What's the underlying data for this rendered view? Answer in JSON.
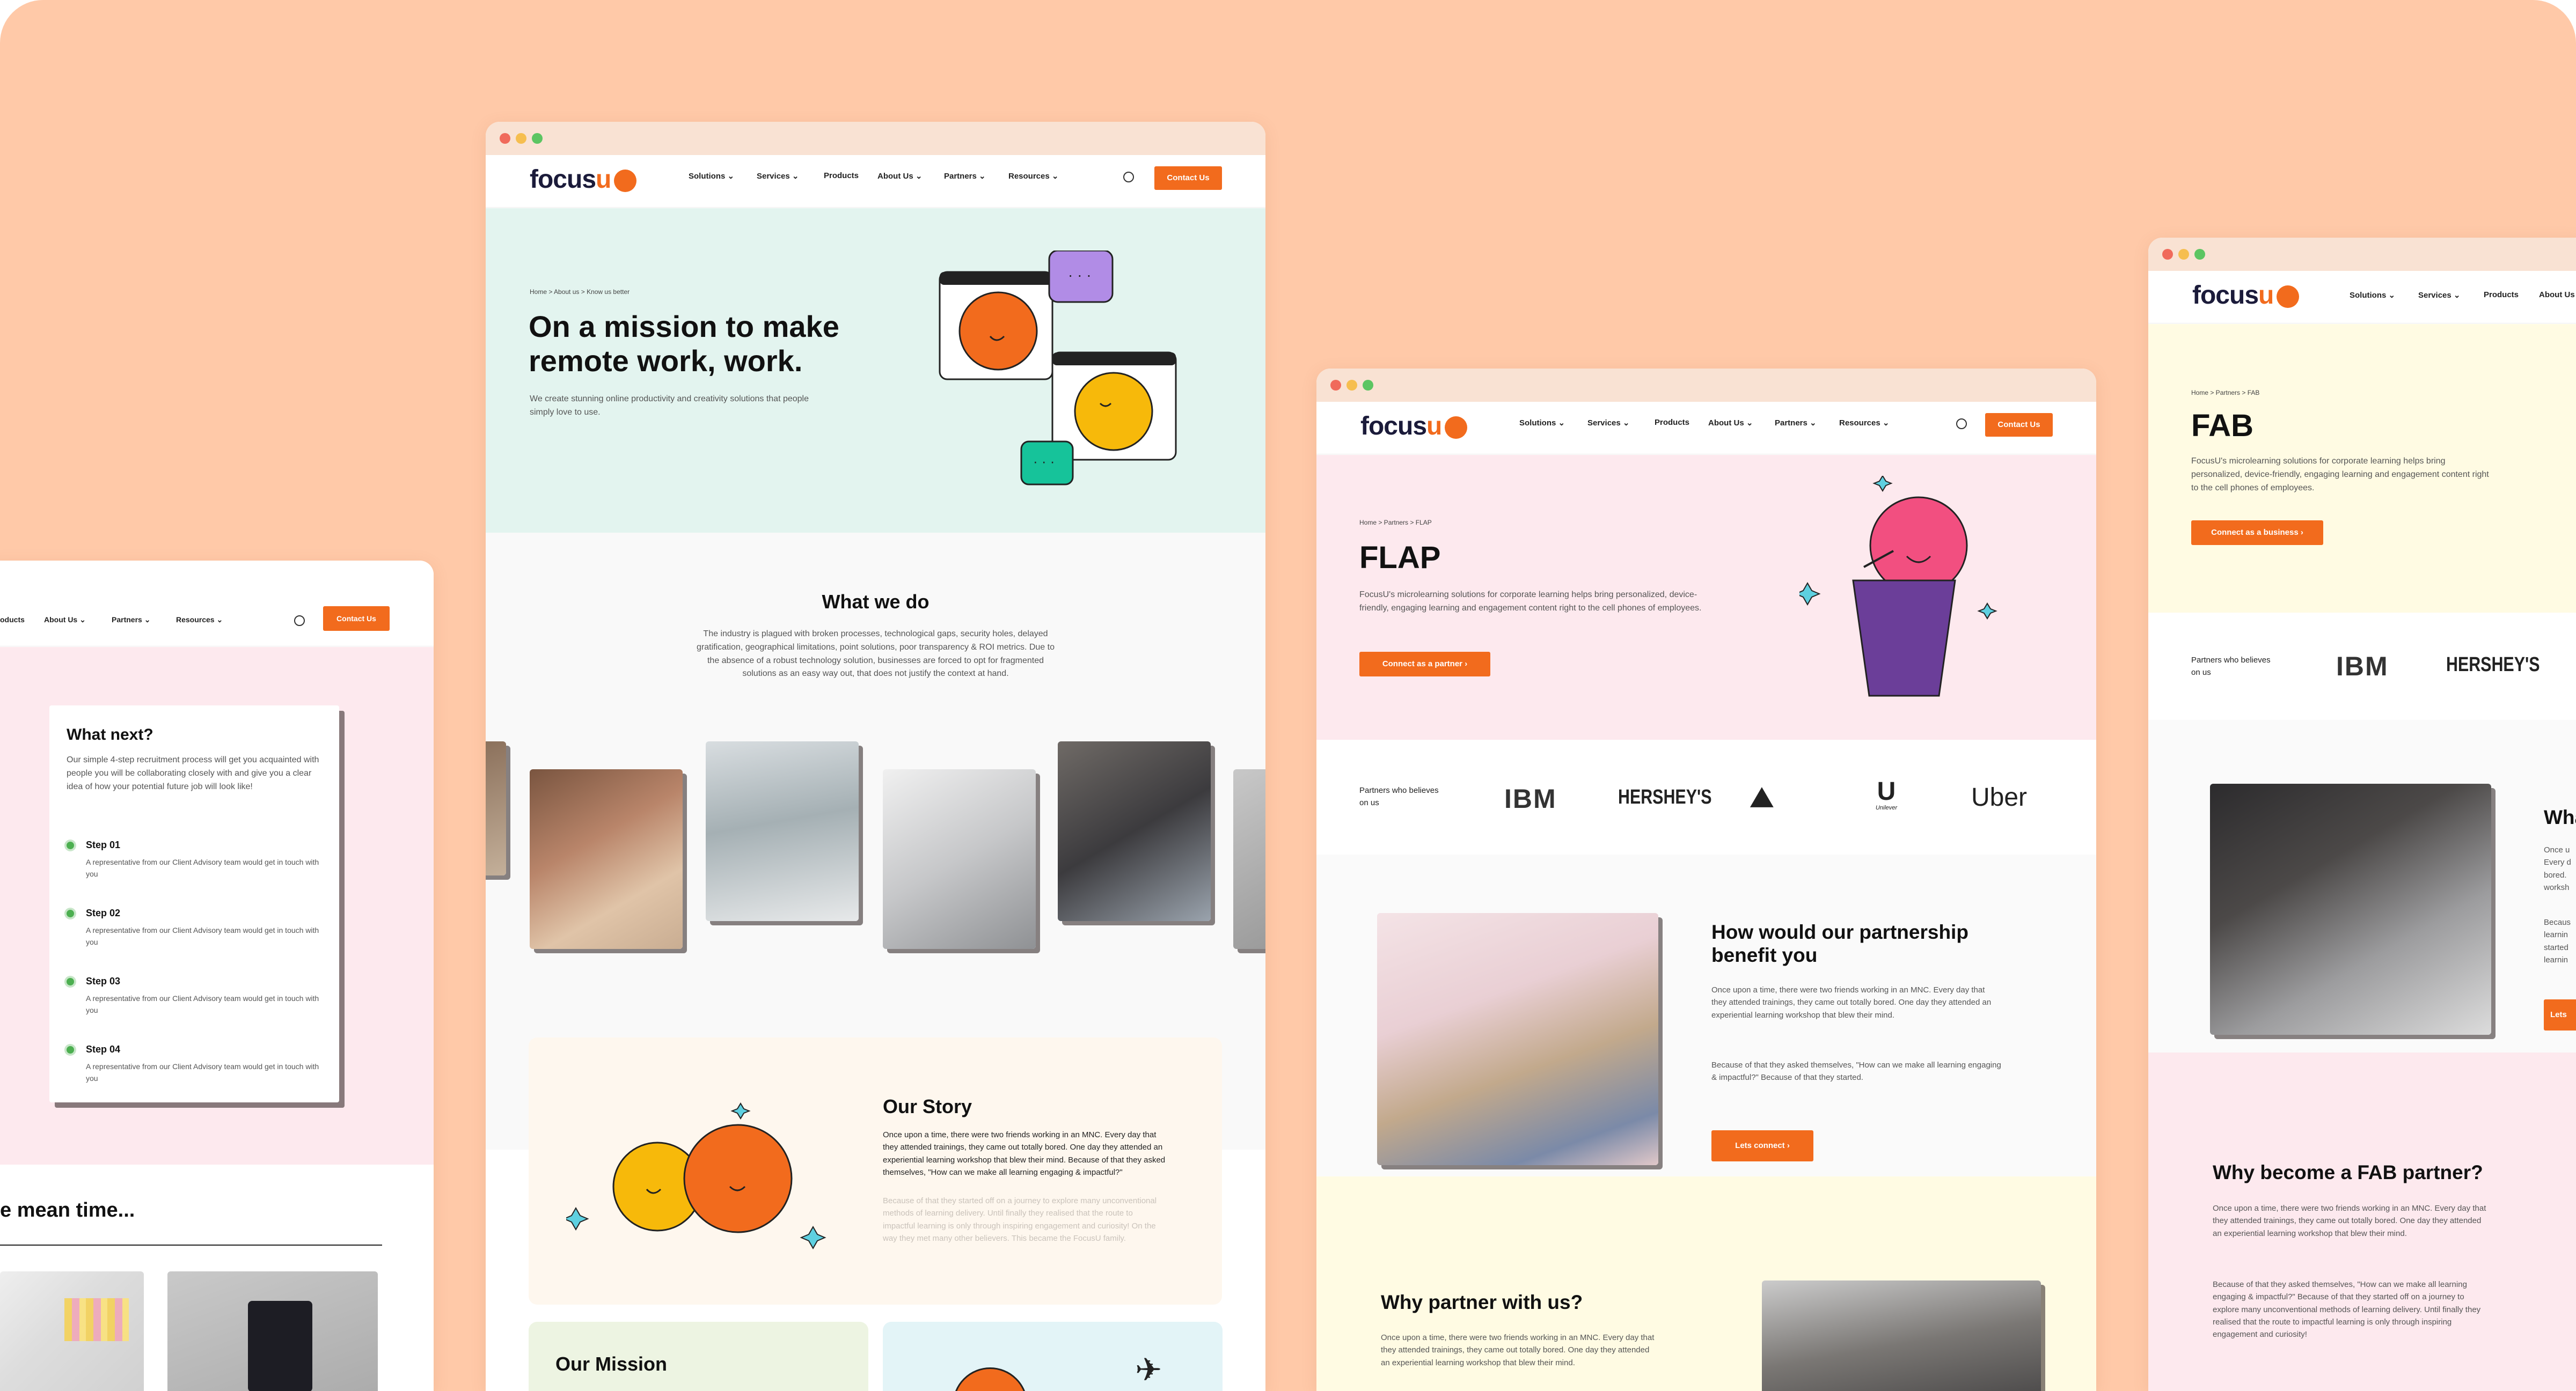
{
  "colors": {
    "canvas": "#ffc9a8",
    "accent": "#f26b1d",
    "mint": "#e3f4ef",
    "pink": "#fde9ee",
    "cream": "#fffbe3",
    "peach": "#fef7ee"
  },
  "logo": {
    "text": "focus",
    "u": "u"
  },
  "nav": {
    "items": [
      "Solutions",
      "Services",
      "Products",
      "About Us",
      "Partners",
      "Resources"
    ],
    "contact": "Contact Us"
  },
  "left_window": {
    "nav": [
      "oducts",
      "About Us",
      "Partners",
      "Resources"
    ],
    "contact": "Contact Us",
    "card_title": "What next?",
    "card_text": "Our simple 4-step recruitment process will get you acquainted with people you will be collaborating closely with and give you a clear idea of how your potential future job will look like!",
    "steps": [
      {
        "title": "Step 01",
        "text": "A representative from our Client Advisory team would get in touch with you"
      },
      {
        "title": "Step 02",
        "text": "A representative from our Client Advisory team would get in touch with you"
      },
      {
        "title": "Step 03",
        "text": "A representative from our Client Advisory team would get in touch with you"
      },
      {
        "title": "Step 04",
        "text": "A representative from our Client Advisory team would get in touch with you"
      }
    ],
    "mean_time": "e mean time..."
  },
  "about_window": {
    "breadcrumb": "Home > About us > Know us better",
    "title_line1": "On a mission to make",
    "title_line2": "remote work, work.",
    "subtitle": "We create stunning online productivity and creativity solutions that people simply love to use.",
    "what_title": "What we do",
    "what_text": "The industry is plagued with broken processes, technological gaps, security holes, delayed gratification, geographical limitations, point solutions, poor transparency & ROI metrics. Due to the absence of a robust technology solution, businesses are forced to opt for fragmented solutions as an easy way out, that does not justify the context at hand.",
    "story_title": "Our Story",
    "story_text": "Once upon a time, there were two friends working in an MNC. Every day that they attended trainings, they came out totally bored. One day they attended an experiential learning workshop that blew their mind. Because of that they asked themselves, \"How can we make all learning engaging & impactful?\"",
    "story_faded": "Because of that they started off on a journey to explore many unconventional methods of learning delivery. Until finally they realised that the route to impactful learning is only through inspiring engagement and curiosity! On the way they met many other believers. This became the FocusU family.",
    "mission_title": "Our Mission"
  },
  "flap_window": {
    "breadcrumb": "Home > Partners > FLAP",
    "title": "FLAP",
    "text": "FocusU's microlearning solutions for corporate learning helps bring personalized, device-friendly, engaging learning and engagement content right to the cell phones of employees.",
    "cta": "Connect as a partner  ›",
    "partners_label": "Partners who believes on us",
    "partners": [
      "IBM",
      "HERSHEY'S",
      "",
      "Unilever",
      "Uber"
    ],
    "benefit_title": "How would our partnership benefit you",
    "benefit_text1": "Once upon a time, there were two friends working in an MNC. Every day that they attended trainings, they came out totally bored. One day they attended an experiential learning workshop that blew their mind.",
    "benefit_text2": "Because of that they asked themselves, \"How can we make all learning engaging & impactful?\" Because of that they started.",
    "lets_connect": "Lets connect  ›",
    "why_title": "Why partner with us?",
    "why_text": "Once upon a time, there were two friends working in an MNC. Every day that they attended trainings, they came out totally bored. One day they attended an experiential learning workshop that blew their mind."
  },
  "fab_window": {
    "nav": [
      "Solutions",
      "Services",
      "Products",
      "About Us"
    ],
    "breadcrumb": "Home > Partners > FAB",
    "title": "FAB",
    "text": "FocusU's microlearning solutions for corporate learning helps bring personalized, device-friendly, engaging learning and engagement content right to the cell phones of employees.",
    "cta": "Connect as a business  ›",
    "partners_label": "Partners who believes on us",
    "partners": [
      "IBM",
      "HERSHEY'S"
    ],
    "peek_title": "Wha",
    "peek_text1": "Once u Every d bored. worksh",
    "peek_text2": "Becaus learnin started learnin",
    "peek_btn": "Lets",
    "why_title": "Why become a FAB partner?",
    "why_text1": "Once upon a time, there were two friends working in an MNC. Every day that they attended trainings, they came out totally bored. One day they attended an experiential learning workshop that blew their mind.",
    "why_text2": "Because of that they asked themselves, \"How can we make all learning engaging & impactful?\" Because of that they started off on a journey to explore many unconventional methods of learning delivery. Until finally they realised that the route to impactful learning is only through inspiring engagement and curiosity!"
  }
}
